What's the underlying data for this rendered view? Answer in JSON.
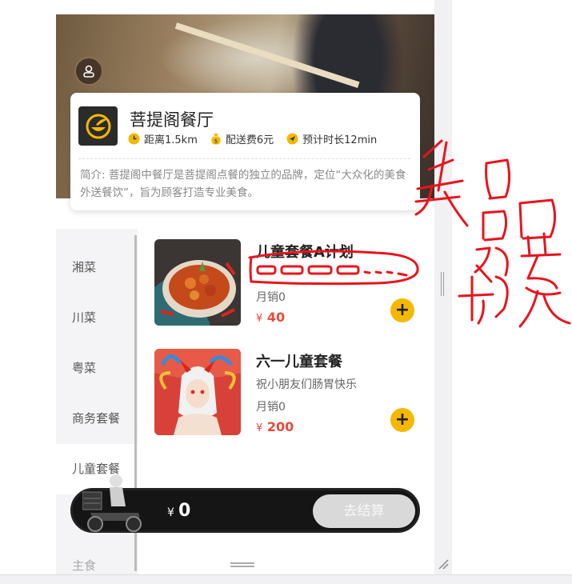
{
  "restaurant": {
    "name": "菩提阁餐厅",
    "distance": "距离1.5km",
    "delivery_fee": "配送费6元",
    "eta": "预计时长12min",
    "intro": "简介: 菩提阁中餐厅是菩提阁点餐的独立的品牌，定位“大众化的美食外送餐饮”，旨为顾客打造专业美食。"
  },
  "categories": [
    {
      "label": "湘菜",
      "active": false
    },
    {
      "label": "川菜",
      "active": false
    },
    {
      "label": "粤菜",
      "active": false
    },
    {
      "label": "商务套餐",
      "active": false
    },
    {
      "label": "儿童套餐",
      "active": true
    },
    {
      "label": "主食",
      "active": false
    }
  ],
  "dishes": [
    {
      "name": "儿童套餐A计划",
      "desc": "",
      "sales": "月销0",
      "currency": "¥",
      "price": "40"
    },
    {
      "name": "六一儿童套餐",
      "desc": "祝小朋友们肠胃快乐",
      "sales": "月销0",
      "currency": "¥",
      "price": "200"
    }
  ],
  "cart": {
    "currency": "¥",
    "total": "0",
    "checkout_label": "去结算"
  },
  "colors": {
    "accent": "#f5b800",
    "price": "#e84b3c",
    "annotation": "#e8141c"
  },
  "icons": {
    "profile": "user-icon",
    "clock": "clock-icon",
    "fee": "money-bag-icon",
    "eta": "navigation-arrow-icon",
    "add": "plus-icon"
  }
}
